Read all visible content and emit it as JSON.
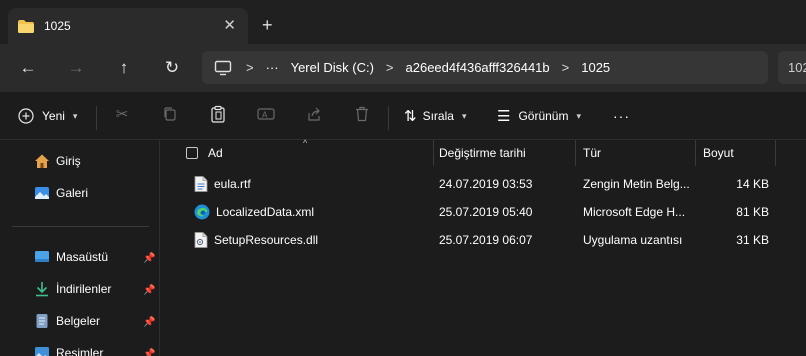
{
  "window": {
    "tab_title": "1025",
    "tab_close": "✕",
    "new_tab": "+"
  },
  "nav": {
    "back": "←",
    "forward": "→",
    "up": "↑",
    "refresh": "↻"
  },
  "address": {
    "more": "···",
    "segments": [
      "Yerel Disk (C:)",
      "a26eed4f436afff326441b",
      "1025"
    ],
    "separator": ">",
    "search_partial": "102"
  },
  "commandbar": {
    "new_label": "Yeni",
    "sort_label": "Sırala",
    "view_label": "Görünüm",
    "more": "···"
  },
  "sidebar": {
    "items": [
      {
        "label": "Giriş",
        "icon": "home-icon"
      },
      {
        "label": "Galeri",
        "icon": "gallery-icon"
      },
      {
        "label": "Masaüstü",
        "icon": "desktop-icon",
        "pinned": true
      },
      {
        "label": "İndirilenler",
        "icon": "download-icon",
        "pinned": true
      },
      {
        "label": "Belgeler",
        "icon": "documents-icon",
        "pinned": true
      },
      {
        "label": "Resimler",
        "icon": "pictures-icon",
        "pinned": true
      }
    ]
  },
  "filelist": {
    "columns": [
      "Ad",
      "Değiştirme tarihi",
      "Tür",
      "Boyut"
    ],
    "rows": [
      {
        "name": "eula.rtf",
        "date": "24.07.2019 03:53",
        "type": "Zengin Metin Belg...",
        "size": "14 KB",
        "icon": "rtf-file-icon"
      },
      {
        "name": "LocalizedData.xml",
        "date": "25.07.2019 05:40",
        "type": "Microsoft Edge H...",
        "size": "81 KB",
        "icon": "edge-file-icon"
      },
      {
        "name": "SetupResources.dll",
        "date": "25.07.2019 06:07",
        "type": "Uygulama uzantısı",
        "size": "31 KB",
        "icon": "dll-file-icon"
      }
    ]
  },
  "colors": {
    "accent_folder": "#f2c24d",
    "window_bg": "#1c1c1c",
    "toolbar_bg": "#2b2b2b"
  }
}
